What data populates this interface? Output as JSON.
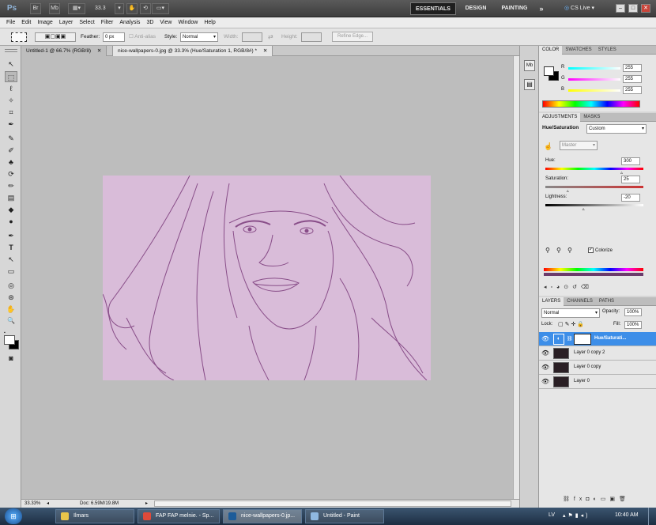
{
  "app_bar": {
    "logo": "Ps",
    "br": "Br",
    "mb": "Mb",
    "zoom": "33.3",
    "workspaces": [
      "ESSENTIALS",
      "DESIGN",
      "PAINTING"
    ],
    "more": "»",
    "cs_live": "CS Live",
    "window_controls": [
      "–",
      "□",
      "✕"
    ]
  },
  "menu": [
    "File",
    "Edit",
    "Image",
    "Layer",
    "Select",
    "Filter",
    "Analysis",
    "3D",
    "View",
    "Window",
    "Help"
  ],
  "options": {
    "feather_label": "Feather:",
    "feather_value": "0 px",
    "antialias": "Anti-alias",
    "style_label": "Style:",
    "style_value": "Normal",
    "width_label": "Width:",
    "height_label": "Height:",
    "refine_edge": "Refine Edge..."
  },
  "tools": [
    "↖",
    "⬚",
    "ℓ",
    "✧",
    "⌗",
    "✒",
    "✎",
    "✐",
    "♣",
    "⟳",
    "✏",
    "▤",
    "◆",
    "●",
    "✒",
    "T",
    "↖",
    "▭",
    "✋",
    "🔍"
  ],
  "tabs": [
    {
      "label": "Untitled-1 @ 66.7% (RGB/8)",
      "close": "✕"
    },
    {
      "label": "nice-wallpapers-0.jpg @ 33.3% (Hue/Saturation 1, RGB/8#) *",
      "close": "✕"
    }
  ],
  "status": {
    "zoom": "33.33%",
    "doc": "Doc: 6.59M/19.8M"
  },
  "color_panel": {
    "tabs": [
      "COLOR",
      "SWATCHES",
      "STYLES"
    ],
    "r_label": "R",
    "g_label": "G",
    "b_label": "B",
    "r": "255",
    "g": "255",
    "b": "255"
  },
  "adjustments": {
    "tabs": [
      "ADJUSTMENTS",
      "MASKS"
    ],
    "title": "Hue/Saturation",
    "preset": "Custom",
    "channel": "Master",
    "hue_label": "Hue:",
    "hue": "300",
    "hue_pos": 0.79,
    "saturation_label": "Saturation:",
    "saturation": "25",
    "saturation_pos": 0.24,
    "lightness_label": "Lightness:",
    "lightness": "-20",
    "lightness_pos": 0.4,
    "colorize_label": "Colorize",
    "colorize": true
  },
  "layers": {
    "tabs": [
      "LAYERS",
      "CHANNELS",
      "PATHS"
    ],
    "blend": "Normal",
    "opacity_label": "Opacity:",
    "opacity": "100%",
    "lock_label": "Lock:",
    "fill_label": "Fill:",
    "fill": "100%",
    "items": [
      {
        "name": "Hue/Saturati...",
        "selected": true
      },
      {
        "name": "Layer 0 copy 2",
        "selected": false
      },
      {
        "name": "Layer 0 copy",
        "selected": false
      },
      {
        "name": "Layer 0",
        "selected": false
      }
    ]
  },
  "taskbar": {
    "items": [
      "Ilmars",
      "FAP FAP melnie. - Sp...",
      "nice-wallpapers-0.jp...",
      "Untitled - Paint"
    ],
    "lang": "LV",
    "time": "10:40 AM"
  },
  "colors": {
    "selected_layer": "#3d8ee8",
    "image_tint": "#d9bcd9",
    "canvas_bg": "#bdbdbd"
  }
}
